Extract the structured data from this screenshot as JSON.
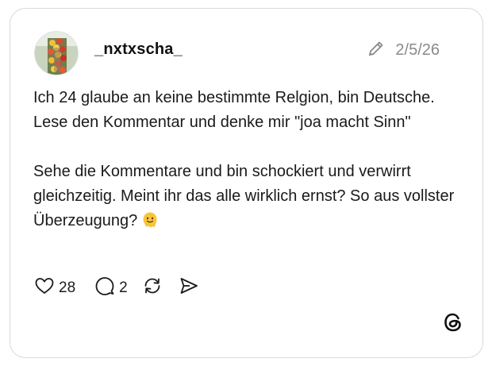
{
  "post": {
    "username": "_nxtxscha_",
    "date": "2/5/26",
    "paragraph1": "Ich 24 glaube an keine bestimmte Relgion, bin Deutsche. Lese den Kommentar und denke mir \"joa macht Sinn\"",
    "paragraph2": "Sehe die Kommentare und bin schockiert und verwirrt gleichzeitig. Meint ihr das alle wirklich ernst? So aus vollster Überzeugung?",
    "emoji": "melting-face-emoji"
  },
  "actions": {
    "likes": "28",
    "replies": "2"
  },
  "icons": [
    "pencil-icon",
    "heart-icon",
    "comment-icon",
    "repost-icon",
    "share-icon",
    "threads-logo-icon"
  ],
  "colors": {
    "border": "#d9d9d9",
    "muted": "#8a8a8a",
    "text": "#1a1a1a"
  }
}
